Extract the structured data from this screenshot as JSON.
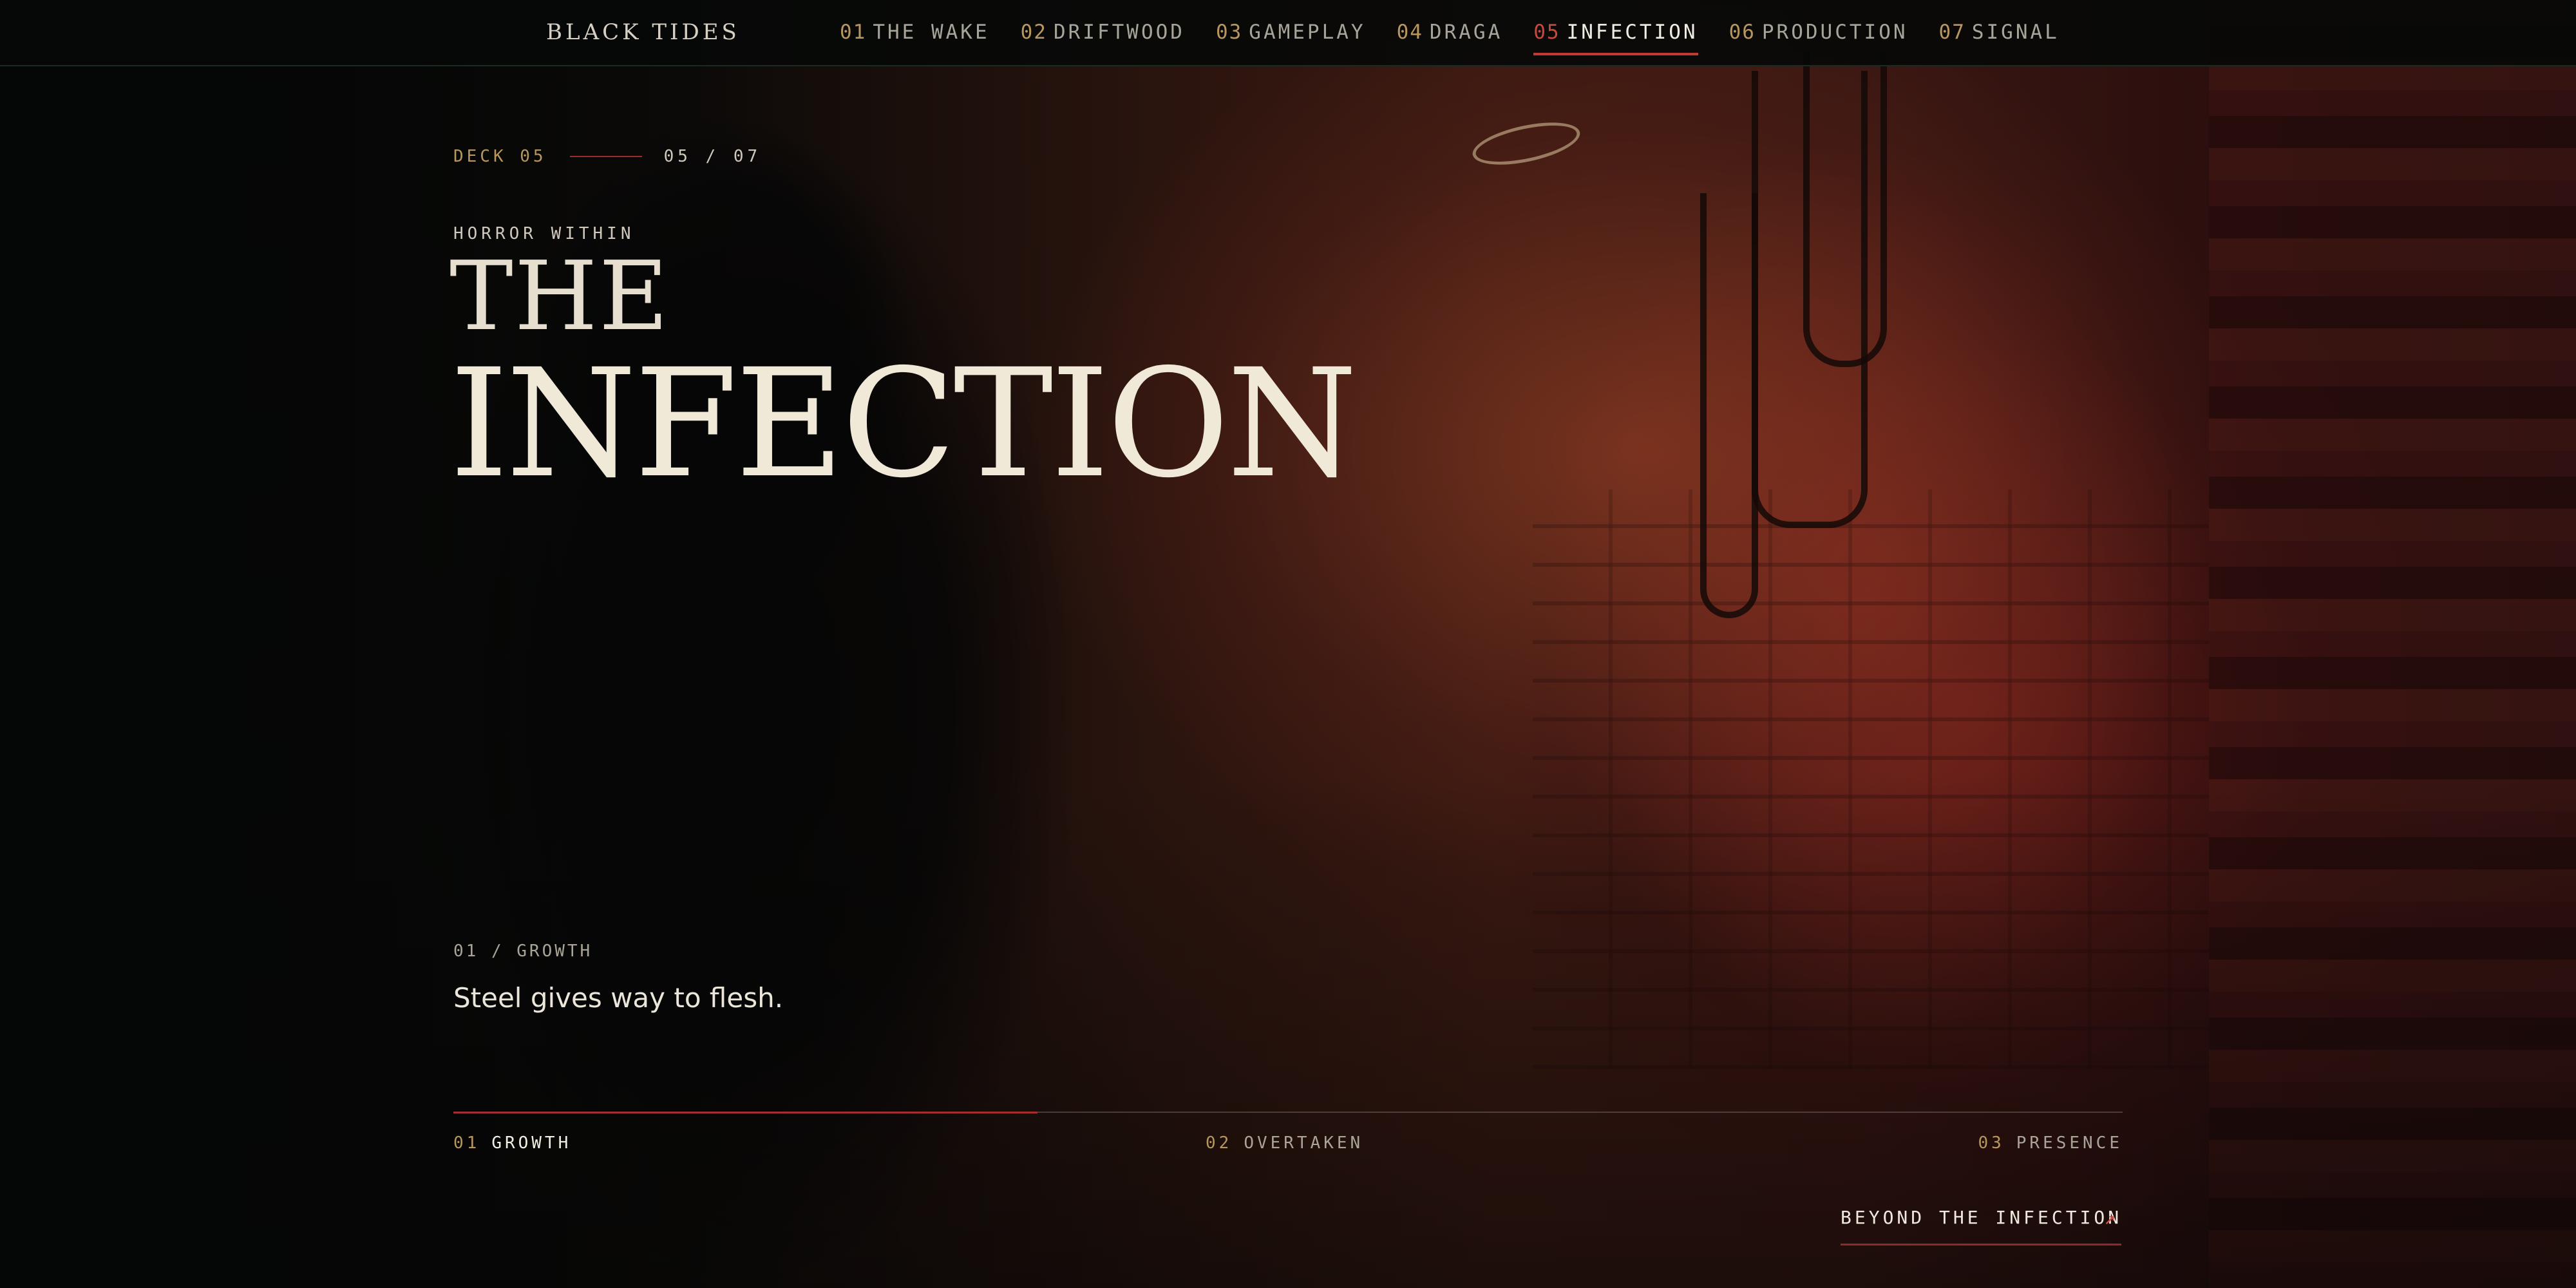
{
  "nav": {
    "brand": "BLACK TIDES",
    "items": [
      {
        "num": "01",
        "label": "THE WAKE"
      },
      {
        "num": "02",
        "label": "DRIFTWOOD"
      },
      {
        "num": "03",
        "label": "GAMEPLAY"
      },
      {
        "num": "04",
        "label": "DRAGA"
      },
      {
        "num": "05",
        "label": "INFECTION"
      },
      {
        "num": "06",
        "label": "PRODUCTION"
      },
      {
        "num": "07",
        "label": "SIGNAL"
      }
    ],
    "active_index": 4
  },
  "hero": {
    "deck_label": "DECK 05",
    "deck_count": "05 / 07",
    "eyebrow": "HORROR WITHIN",
    "title_line1": "THE",
    "title_line2": "INFECTION",
    "step_label": "01 / GROWTH",
    "step_text": "Steel gives way to flesh."
  },
  "steps": {
    "items": [
      {
        "num": "01",
        "label": "GROWTH"
      },
      {
        "num": "02",
        "label": "OVERTAKEN"
      },
      {
        "num": "03",
        "label": "PRESENCE"
      }
    ],
    "active_index": 0,
    "progress_fraction": 0.35
  },
  "cta": {
    "label": "BEYOND THE INFECTION",
    "icon": "arrow-up-right-icon"
  },
  "colors": {
    "accent_red": "#c23a34",
    "accent_gold": "#b8965e",
    "text_cream": "#f0e9d8",
    "background": "#070808"
  }
}
